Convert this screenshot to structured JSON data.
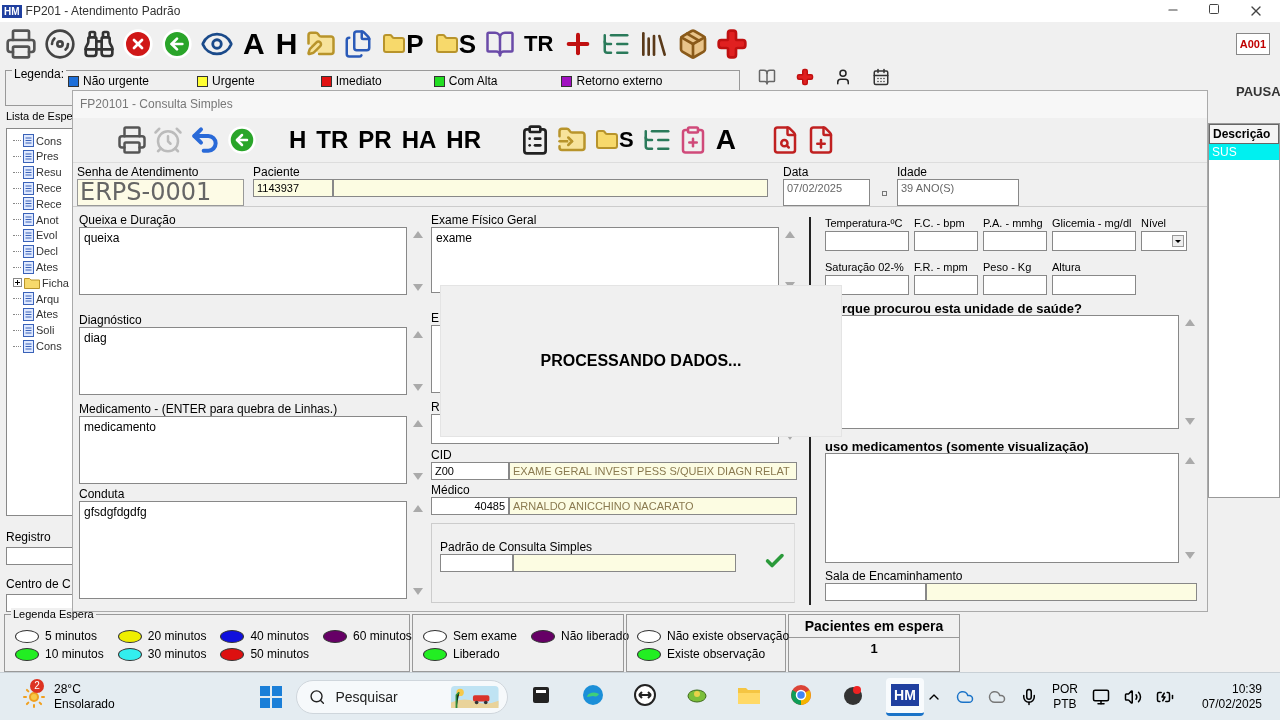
{
  "window": {
    "logo": "HM",
    "title": "FP201 - Atendimento Padrão"
  },
  "toolbar": {
    "labels": [
      "A",
      "H",
      "P",
      "S",
      "TR"
    ],
    "user_button": "A001"
  },
  "legend": {
    "title": "Legenda:",
    "items": [
      {
        "label": "Não urgente",
        "color": "#1e6fd9"
      },
      {
        "label": "Urgente",
        "color": "#ffff33"
      },
      {
        "label": "Imediato",
        "color": "#e01010"
      },
      {
        "label": "Com Alta",
        "color": "#22dd22"
      },
      {
        "label": "Retorno externo",
        "color": "#a010c0"
      }
    ]
  },
  "status_text": "PAUSA",
  "waiting_list": {
    "title": "Lista de Espe",
    "tree": [
      {
        "label": "Cons",
        "kind": "doc"
      },
      {
        "label": "Pres",
        "kind": "doc"
      },
      {
        "label": "Resu",
        "kind": "doc"
      },
      {
        "label": "Rece",
        "kind": "doc"
      },
      {
        "label": "Rece",
        "kind": "doc"
      },
      {
        "label": "Anot",
        "kind": "doc"
      },
      {
        "label": "Evol",
        "kind": "doc"
      },
      {
        "label": "Decl",
        "kind": "doc"
      },
      {
        "label": "Ates",
        "kind": "doc"
      },
      {
        "label": "Ficha",
        "kind": "folder",
        "expanded": false
      },
      {
        "label": "Arqu",
        "kind": "doc"
      },
      {
        "label": "Ates",
        "kind": "doc"
      },
      {
        "label": "Soli",
        "kind": "doc"
      },
      {
        "label": "Cons",
        "kind": "doc"
      }
    ]
  },
  "registro": {
    "label": "Registro"
  },
  "centro": {
    "label": "Centro de C"
  },
  "table": {
    "columns": [
      "Descrição"
    ],
    "rows": [
      {
        "cells": [
          "SUS"
        ],
        "selected": true
      }
    ]
  },
  "dialog": {
    "title": "FP20101 - Consulta Simples",
    "toolbar_labels": [
      "H",
      "TR",
      "PR",
      "HA",
      "HR",
      "S",
      "A"
    ],
    "senha": {
      "label": "Senha de Atendimento",
      "value": "ERPS-0001"
    },
    "paciente": {
      "label": "Paciente",
      "code": "1143937"
    },
    "data": {
      "label": "Data",
      "value": "07/02/2025"
    },
    "idade": {
      "label": "Idade",
      "value": "39 ANO(S)"
    },
    "left_fields": [
      {
        "label": "Queixa e Duração",
        "value": "queixa"
      },
      {
        "label": "Diagnóstico",
        "value": "diag"
      },
      {
        "label": "Medicamento - (ENTER para quebra de Linhas.)",
        "value": "medicamento"
      },
      {
        "label": "Conduta",
        "value": "gfsdgfdgdfg"
      }
    ],
    "middle_fields": [
      {
        "label": "Exame Físico Geral",
        "value": "exame"
      },
      {
        "label": "E"
      },
      {
        "label": "R"
      }
    ],
    "cid": {
      "label": "CID",
      "code": "Z00",
      "description": "EXAME GERAL INVEST PESS S/QUEIX DIAGN RELAT"
    },
    "medico": {
      "label": "Médico",
      "code": "40485",
      "name": "ARNALDO ANICCHINO NACARATO"
    },
    "padrao": {
      "label": "Padrão de Consulta Simples"
    },
    "vitals": [
      {
        "label": "Temperatura-ºC",
        "kind": "input"
      },
      {
        "label": "F.C. - bpm",
        "kind": "input"
      },
      {
        "label": "P.A. - mmhg",
        "kind": "input"
      },
      {
        "label": "Glicemia - mg/dl",
        "kind": "input"
      },
      {
        "label": "Nível",
        "kind": "select"
      },
      {
        "label": "Saturação 02-%",
        "kind": "input"
      },
      {
        "label": "F.R. - mpm",
        "kind": "input"
      },
      {
        "label": "Peso - Kg",
        "kind": "input"
      },
      {
        "label": "Altura",
        "kind": "input"
      }
    ],
    "right_fields": [
      {
        "label": "rque procurou esta unidade de saúde?"
      },
      {
        "label": "uso medicamentos (somente visualização)"
      }
    ],
    "sala": {
      "label": "Sala de Encaminhamento"
    },
    "processing": {
      "message": "PROCESSANDO DADOS..."
    }
  },
  "bottom_legends": [
    {
      "title": "Legenda Espera",
      "items": [
        {
          "label": "5 minutos",
          "color": "#ffffff"
        },
        {
          "label": "10 minutos",
          "color": "#22ee22"
        },
        {
          "label": "20 minutos",
          "color": "#eeee00"
        },
        {
          "label": "30 minutos",
          "color": "#33eeee"
        },
        {
          "label": "40 minutos",
          "color": "#1010dd"
        },
        {
          "label": "50 minutos",
          "color": "#dd1010"
        },
        {
          "label": "60 minutos",
          "color": "#660066"
        }
      ]
    },
    {
      "items": [
        {
          "label": "Sem exame",
          "color": "#ffffff"
        },
        {
          "label": "Liberado",
          "color": "#22ee22"
        },
        {
          "label": "Não liberado",
          "color": "#660066"
        }
      ]
    },
    {
      "items": [
        {
          "label": "Não existe observação",
          "color": "#ffffff"
        },
        {
          "label": "Existe observação",
          "color": "#22ee22"
        }
      ]
    }
  ],
  "waiting_count": {
    "label": "Pacientes em espera",
    "value": "1"
  },
  "taskbar": {
    "weather": {
      "badge": "2",
      "temperature": "28°C",
      "condition": "Ensolarado"
    },
    "search": {
      "placeholder": "Pesquisar"
    },
    "apps": [
      {
        "kind": "notes",
        "selected": false
      },
      {
        "kind": "edge",
        "selected": false
      },
      {
        "kind": "remote",
        "selected": false
      },
      {
        "kind": "game",
        "selected": false
      },
      {
        "kind": "folder",
        "selected": false
      },
      {
        "kind": "chrome",
        "selected": false
      },
      {
        "kind": "recorder",
        "selected": false
      },
      {
        "kind": "hm",
        "label": "HM",
        "selected": true
      }
    ],
    "language": [
      "POR",
      "PTB"
    ],
    "time": "10:39",
    "date": "07/02/2025"
  }
}
